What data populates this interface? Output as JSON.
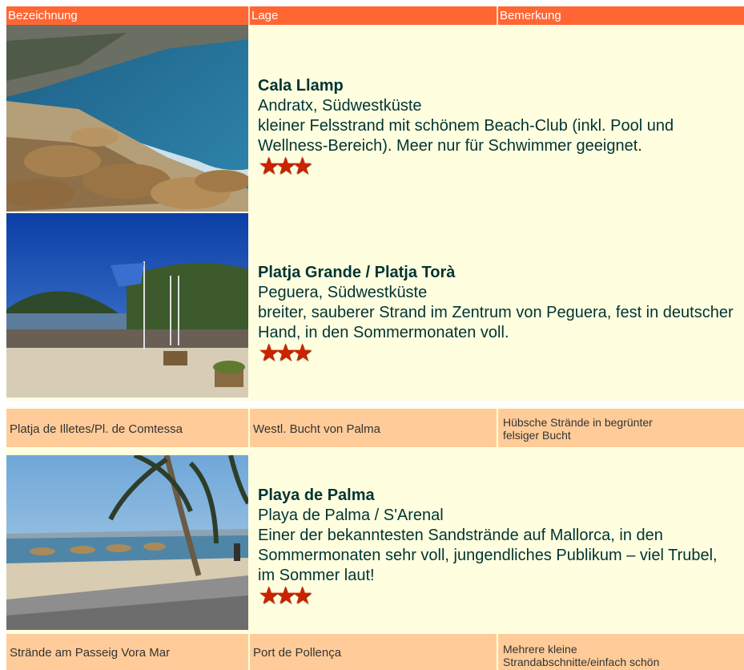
{
  "header": {
    "col1": "Bezeichnung",
    "col2": "Lage",
    "col3": "Bemerkung"
  },
  "beaches": {
    "cala_llamp": {
      "name": "Cala Llamp",
      "location": "Andratx, Südwestküste",
      "remark": "kleiner Felsstrand mit schönem Beach-Club (inkl. Pool und Wellness-Bereich). Meer nur für Schwimmer geeignet.",
      "rating": 3
    },
    "platja_grande": {
      "name": "Platja Grande / Platja Torà",
      "location": "Peguera, Südwestküste",
      "remark": "breiter, sauberer Strand im Zentrum von Peguera, fest in deutscher Hand, in den Sommermonaten voll.",
      "rating": 3
    },
    "illetes": {
      "name": "Platja de Illetes/Pl. de Comtessa",
      "location": "Westl. Bucht von Palma",
      "remark": "Hübsche Strände in begrünter felsiger Bucht"
    },
    "playa_de_palma": {
      "name": "Playa de Palma",
      "location": "Playa de Palma / S'Arenal",
      "remark": "Einer der bekanntesten Sandstrände auf Mallorca, in den Sommermonaten sehr voll, jungendliches Publikum – viel Trubel, im Sommer laut!",
      "rating": 3
    },
    "vora_mar": {
      "name": "Strände am Passeig Vora Mar",
      "location": "Port de Pollença",
      "remark": "Mehrere kleine Strandabschnitte/einfach schön"
    }
  },
  "colors": {
    "header_bg": "#ff6633",
    "row_bg": "#ffcc99",
    "feature_bg": "#ffffe0",
    "title_text": "#003333",
    "star": "#cc2200"
  }
}
